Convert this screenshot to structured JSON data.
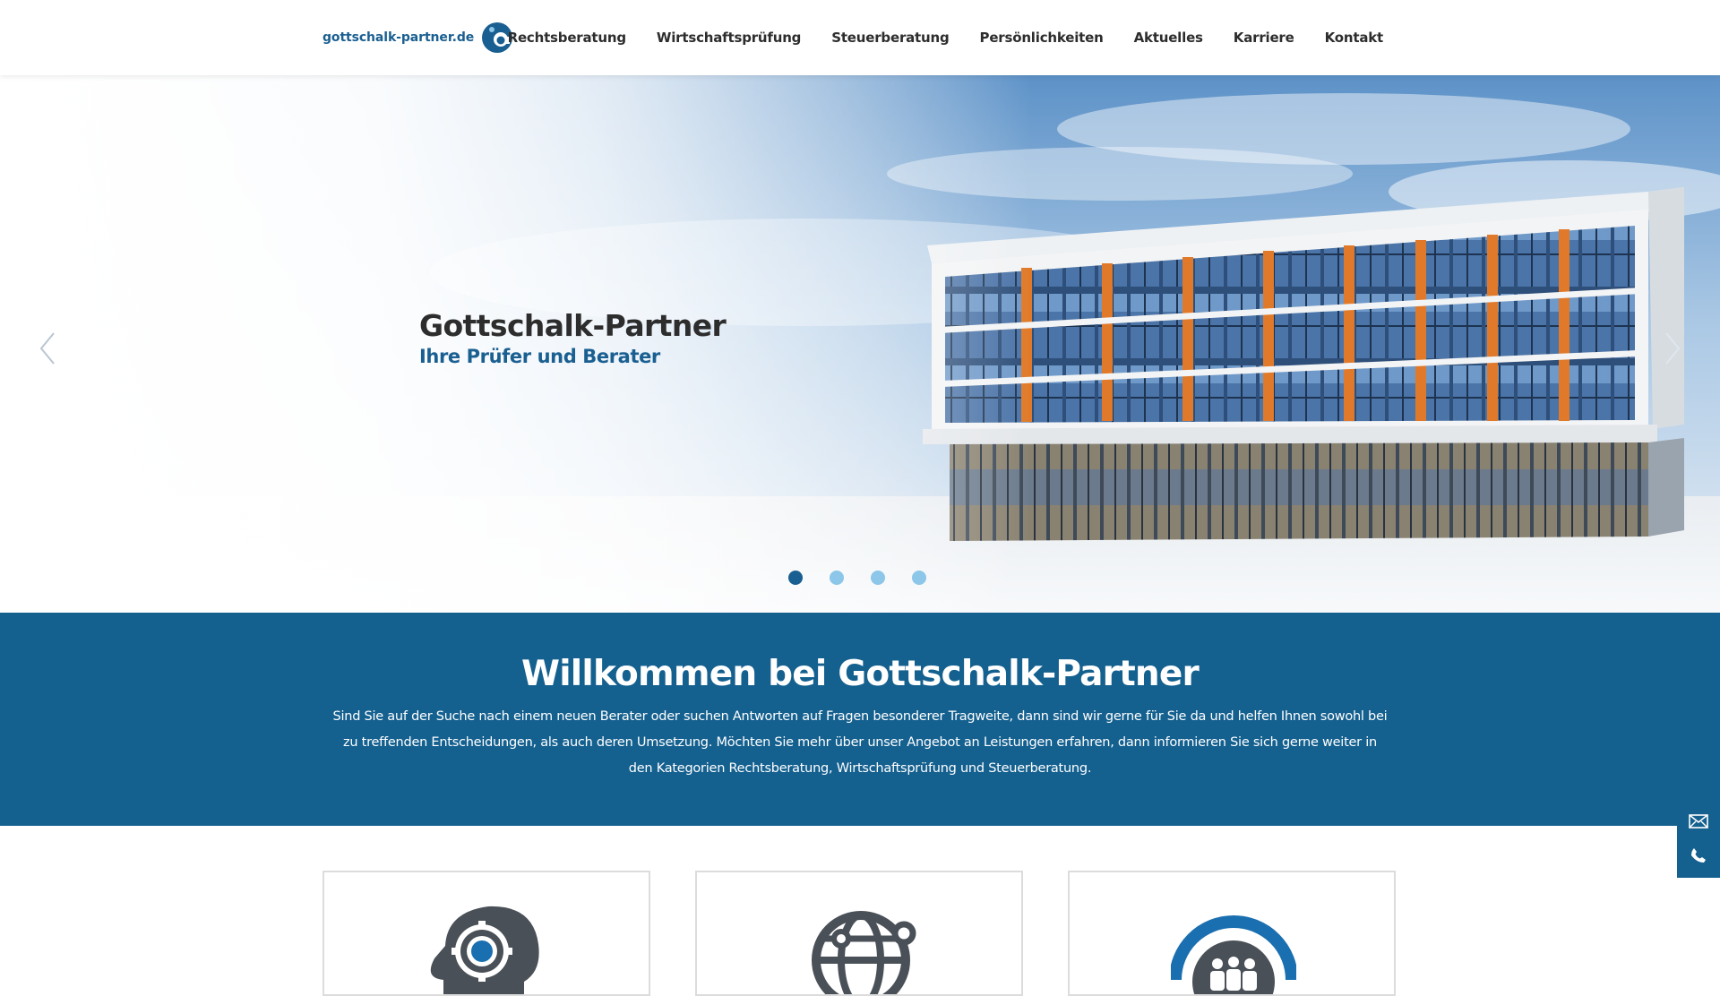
{
  "header": {
    "logo_text": "gottschalk-partner.de",
    "nav": [
      {
        "label": "Rechtsberatung"
      },
      {
        "label": "Wirtschaftsprüfung"
      },
      {
        "label": "Steuerberatung"
      },
      {
        "label": "Persönlichkeiten"
      },
      {
        "label": "Aktuelles"
      },
      {
        "label": "Karriere"
      },
      {
        "label": "Kontakt"
      }
    ]
  },
  "hero": {
    "title": "Gottschalk-Partner",
    "subtitle": "Ihre Prüfer und Berater",
    "slide_count": 4,
    "active_slide": 1,
    "icons": {
      "prev": "chevron-left-icon",
      "next": "chevron-right-icon"
    }
  },
  "welcome": {
    "title": "Willkommen bei Gottschalk-Partner",
    "text": "Sind Sie auf der Suche nach einem neuen Berater oder suchen Antworten auf Fragen besonderer Tragweite, dann sind wir gerne für Sie da und helfen Ihnen sowohl bei zu treffenden Entscheidungen, als auch deren Umsetzung. Möchten Sie mehr über unser Angebot an Leistungen erfahren, dann informieren Sie sich gerne weiter in den Kategorien Rechtsberatung, Wirtschaftsprüfung und Steuerberatung."
  },
  "cards": [
    {
      "icon": "gear-head-icon"
    },
    {
      "icon": "globe-network-icon"
    },
    {
      "icon": "team-circle-icon"
    }
  ],
  "side_contact": {
    "icons": [
      "mail-icon",
      "phone-icon"
    ]
  },
  "colors": {
    "brand_blue": "#14608f",
    "dot_inactive": "#8cc6e8",
    "accent_orange": "#e07a2a",
    "text_dark": "#2d2d2d"
  }
}
